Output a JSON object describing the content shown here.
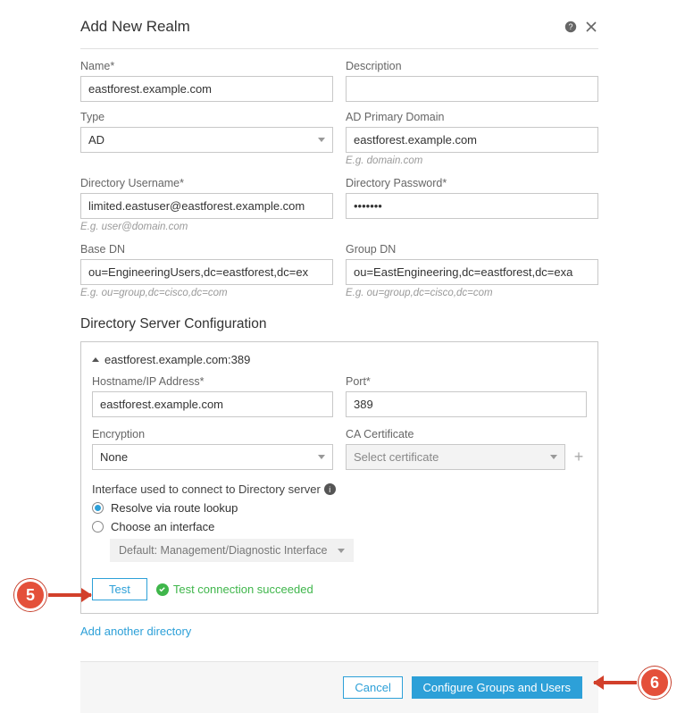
{
  "header": {
    "title": "Add New Realm"
  },
  "form": {
    "name": {
      "label": "Name*",
      "value": "eastforest.example.com"
    },
    "description": {
      "label": "Description",
      "value": ""
    },
    "type": {
      "label": "Type",
      "value": "AD"
    },
    "ad_primary_domain": {
      "label": "AD Primary Domain",
      "value": "eastforest.example.com",
      "hint": "E.g. domain.com"
    },
    "dir_username": {
      "label": "Directory Username*",
      "value": "limited.eastuser@eastforest.example.com",
      "hint": "E.g. user@domain.com"
    },
    "dir_password": {
      "label": "Directory Password*",
      "value": "•••••••"
    },
    "base_dn": {
      "label": "Base DN",
      "value": "ou=EngineeringUsers,dc=eastforest,dc=ex",
      "hint": "E.g. ou=group,dc=cisco,dc=com"
    },
    "group_dn": {
      "label": "Group DN",
      "value": "ou=EastEngineering,dc=eastforest,dc=exa",
      "hint": "E.g. ou=group,dc=cisco,dc=com"
    }
  },
  "dir_server": {
    "section_title": "Directory Server Configuration",
    "panel_title": "eastforest.example.com:389",
    "hostname": {
      "label": "Hostname/IP Address*",
      "value": "eastforest.example.com"
    },
    "port": {
      "label": "Port*",
      "value": "389"
    },
    "encryption": {
      "label": "Encryption",
      "value": "None"
    },
    "ca_cert": {
      "label": "CA Certificate",
      "value": "Select certificate"
    },
    "interface_label": "Interface used to connect to Directory server",
    "radio_resolve": "Resolve via route lookup",
    "radio_choose": "Choose an interface",
    "iface_select": "Default: Management/Diagnostic Interface",
    "test_btn": "Test",
    "test_status": "Test connection succeeded"
  },
  "links": {
    "add_dir": "Add another directory"
  },
  "footer": {
    "cancel": "Cancel",
    "primary": "Configure Groups and Users"
  },
  "callouts": {
    "five": "5",
    "six": "6"
  }
}
